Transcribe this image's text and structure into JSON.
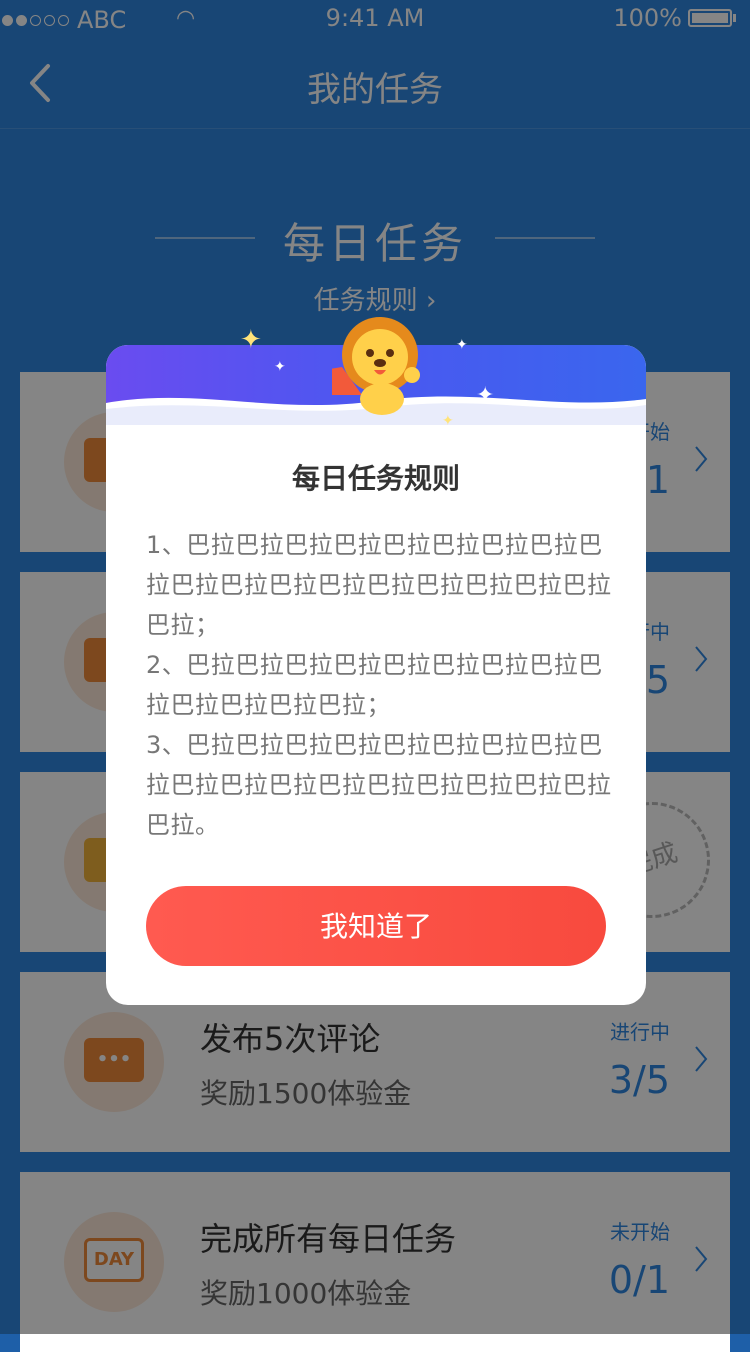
{
  "status_bar": {
    "carrier": "ABC",
    "time": "9:41 AM",
    "battery": "100%"
  },
  "nav": {
    "title": "我的任务"
  },
  "section": {
    "title": "每日任务",
    "rules_link": "任务规则"
  },
  "tasks": [
    {
      "name": "",
      "reward": "",
      "status": "未开始",
      "progress": "0/1"
    },
    {
      "name": "",
      "reward": "",
      "status": "进行中",
      "progress": "3/5"
    },
    {
      "name": "",
      "reward": "",
      "status": "",
      "progress": "",
      "stamp": "完成"
    },
    {
      "name": "发布5次评论",
      "reward": "奖励1500体验金",
      "status": "进行中",
      "progress": "3/5"
    },
    {
      "name": "完成所有每日任务",
      "reward": "奖励1000体验金",
      "status": "未开始",
      "progress": "0/1",
      "icon_text": "DAY"
    }
  ],
  "modal": {
    "title": "每日任务规则",
    "rules": [
      "1、巴拉巴拉巴拉巴拉巴拉巴拉巴拉巴拉巴拉巴拉巴拉巴拉巴拉巴拉巴拉巴拉巴拉巴拉巴拉；",
      "2、巴拉巴拉巴拉巴拉巴拉巴拉巴拉巴拉巴拉巴拉巴拉巴拉巴拉；",
      "3、巴拉巴拉巴拉巴拉巴拉巴拉巴拉巴拉巴拉巴拉巴拉巴拉巴拉巴拉巴拉巴拉巴拉巴拉巴拉。"
    ],
    "confirm_label": "我知道了"
  },
  "colors": {
    "accent_blue": "#2f86e0",
    "button_red": "#f84a3e",
    "header_purple": "#6a4cf0"
  }
}
